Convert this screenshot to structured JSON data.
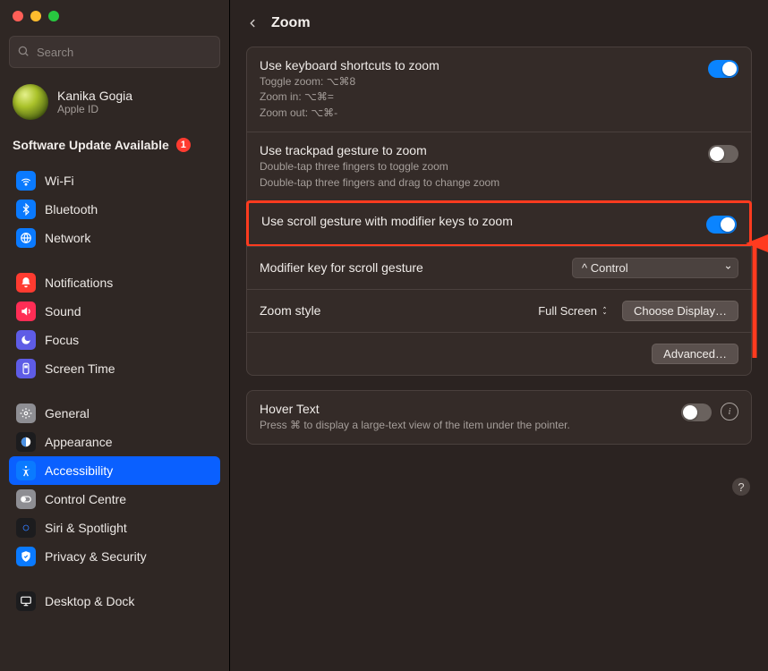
{
  "window": {
    "title": "Zoom"
  },
  "search": {
    "placeholder": "Search"
  },
  "user": {
    "name": "Kanika Gogia",
    "sub": "Apple ID"
  },
  "update": {
    "label": "Software Update Available",
    "count": "1"
  },
  "nav": {
    "groups": [
      [
        {
          "id": "wifi",
          "label": "Wi-Fi",
          "bg": "#0a7aff"
        },
        {
          "id": "bluetooth",
          "label": "Bluetooth",
          "bg": "#0a7aff"
        },
        {
          "id": "network",
          "label": "Network",
          "bg": "#0a7aff"
        }
      ],
      [
        {
          "id": "notifications",
          "label": "Notifications",
          "bg": "#ff3b30"
        },
        {
          "id": "sound",
          "label": "Sound",
          "bg": "#ff2d55"
        },
        {
          "id": "focus",
          "label": "Focus",
          "bg": "#5e5ce6"
        },
        {
          "id": "screentime",
          "label": "Screen Time",
          "bg": "#5e5ce6"
        }
      ],
      [
        {
          "id": "general",
          "label": "General",
          "bg": "#8e8e93"
        },
        {
          "id": "appearance",
          "label": "Appearance",
          "bg": "#1c1c1e"
        },
        {
          "id": "accessibility",
          "label": "Accessibility",
          "bg": "#0a7aff",
          "selected": true
        },
        {
          "id": "controlcentre",
          "label": "Control Centre",
          "bg": "#8e8e93"
        },
        {
          "id": "siri",
          "label": "Siri & Spotlight",
          "bg": "#1c1c1e"
        },
        {
          "id": "privacy",
          "label": "Privacy & Security",
          "bg": "#0a7aff"
        }
      ],
      [
        {
          "id": "desktop",
          "label": "Desktop & Dock",
          "bg": "#1c1c1e"
        }
      ]
    ]
  },
  "main": {
    "panel1": {
      "r1": {
        "title": "Use keyboard shortcuts to zoom",
        "sub": "Toggle zoom:  ⌥⌘8\nZoom in:  ⌥⌘=\nZoom out: ⌥⌘-",
        "on": true
      },
      "r2": {
        "title": "Use trackpad gesture to zoom",
        "sub": "Double-tap three fingers to toggle zoom\nDouble-tap three fingers and drag to change zoom",
        "on": false
      },
      "r3": {
        "title": "Use scroll gesture with modifier keys to zoom",
        "on": true
      },
      "r4": {
        "title": "Modifier key for scroll gesture",
        "value": "^ Control"
      },
      "r5": {
        "title": "Zoom style",
        "value": "Full Screen",
        "button": "Choose Display…"
      },
      "r6": {
        "button": "Advanced…"
      }
    },
    "panel2": {
      "title": "Hover Text",
      "sub": "Press ⌘ to display a large-text view of the item under the pointer.",
      "on": false
    }
  }
}
